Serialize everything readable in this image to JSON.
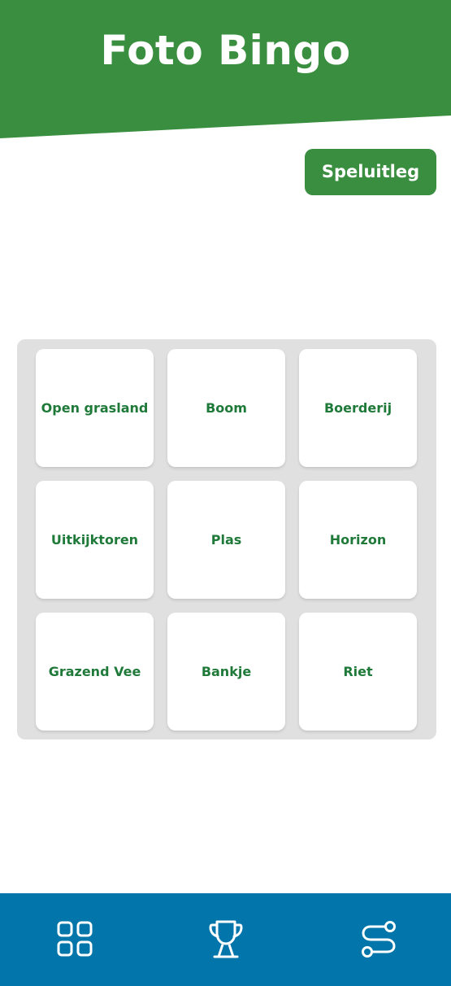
{
  "header": {
    "title": "Foto Bingo",
    "background_color": "#3a8e3f"
  },
  "help_button": {
    "label": "Speluitleg"
  },
  "bingo": {
    "cells": [
      {
        "label": "Open grasland"
      },
      {
        "label": "Boom"
      },
      {
        "label": "Boerderij"
      },
      {
        "label": "Uitkijktoren"
      },
      {
        "label": "Plas"
      },
      {
        "label": "Horizon"
      },
      {
        "label": "Grazend Vee"
      },
      {
        "label": "Bankje"
      },
      {
        "label": "Riet"
      }
    ],
    "label_color": "#1f7a3a",
    "board_color": "#e0e0e0"
  },
  "bottom_nav": {
    "background_color": "#0276aa",
    "items": [
      {
        "icon": "grid-icon"
      },
      {
        "icon": "trophy-icon"
      },
      {
        "icon": "route-icon"
      }
    ]
  }
}
